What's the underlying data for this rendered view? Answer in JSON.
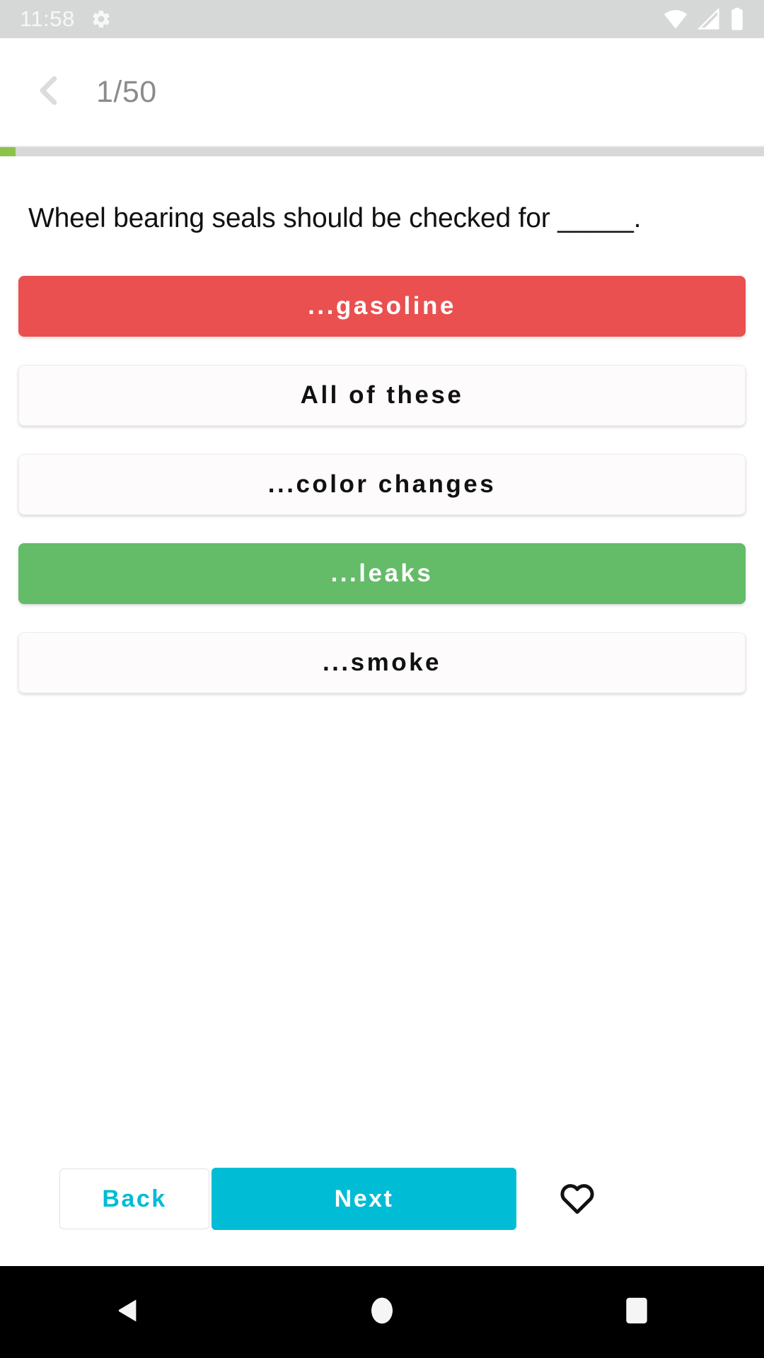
{
  "status_bar": {
    "time": "11:58",
    "icons": [
      "gear-icon",
      "wifi-icon",
      "cellular-signal-icon",
      "battery-icon"
    ],
    "background": "#d6d8d7"
  },
  "app_bar": {
    "back_icon": "chevron-left-icon",
    "counter": "1/50",
    "current": 1,
    "total": 50
  },
  "progress": {
    "percent": 2,
    "fill_color": "#8bc34a",
    "track_color": "#d8d8d8"
  },
  "question": {
    "text": "Wheel bearing seals should be checked for _____."
  },
  "options": [
    {
      "label": "...gasoline",
      "state": "wrong",
      "color": "#ea5050"
    },
    {
      "label": "All of these",
      "state": "neutral",
      "color": "#fdfbfc"
    },
    {
      "label": "...color changes",
      "state": "neutral",
      "color": "#fdfbfc"
    },
    {
      "label": "...leaks",
      "state": "correct",
      "color": "#64bb68"
    },
    {
      "label": "...smoke",
      "state": "neutral",
      "color": "#fdfbfc"
    }
  ],
  "bottom_bar": {
    "back_label": "Back",
    "next_label": "Next",
    "accent_color": "#00bcd4",
    "favorite_icon": "heart-outline-icon"
  },
  "nav_bar": {
    "back_icon": "triangle-back-icon",
    "home_icon": "circle-home-icon",
    "recents_icon": "square-recents-icon"
  }
}
